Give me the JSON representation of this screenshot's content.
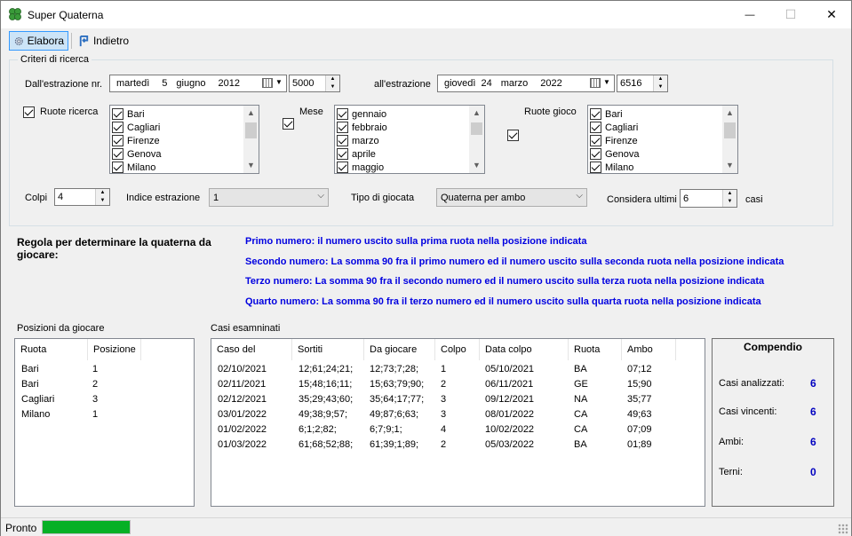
{
  "window": {
    "title": "Super Quaterna",
    "minimize": "—",
    "maximize": "☐",
    "close": "✕"
  },
  "toolbar": {
    "elabora": "Elabora",
    "indietro": "Indietro"
  },
  "criteria": {
    "group_title": "Criteri di ricerca",
    "from_label": "Dall'estrazione nr.",
    "from_date": {
      "day_name": "martedì",
      "day": "5",
      "month": "giugno",
      "year": "2012"
    },
    "from_number": "5000",
    "to_label": "all'estrazione",
    "to_date": {
      "day_name": "giovedì",
      "day": "24",
      "month": "marzo",
      "year": "2022"
    },
    "to_number": "6516",
    "ruote_ricerca_label": "Ruote ricerca",
    "ruote_ricerca": [
      "Bari",
      "Cagliari",
      "Firenze",
      "Genova",
      "Milano"
    ],
    "mese_label": "Mese",
    "mesi": [
      "gennaio",
      "febbraio",
      "marzo",
      "aprile",
      "maggio"
    ],
    "ruote_gioco_label": "Ruote gioco",
    "ruote_gioco": [
      "Bari",
      "Cagliari",
      "Firenze",
      "Genova",
      "Milano"
    ],
    "colpi_label": "Colpi",
    "colpi": "4",
    "indice_label": "Indice estrazione",
    "indice": "1",
    "tipo_label": "Tipo di giocata",
    "tipo": "Quaterna per ambo",
    "considera_label": "Considera ultimi",
    "considera": "6",
    "casi_label": "casi"
  },
  "rules": {
    "heading": "Regola per determinare la quaterna da giocare:",
    "line1": "Primo numero: il numero uscito sulla prima ruota nella posizione indicata",
    "line2": "Secondo numero: La somma 90 fra il primo numero ed il numero uscito sulla seconda ruota nella posizione indicata",
    "line3": "Terzo numero: La somma 90 fra il secondo numero ed il numero uscito sulla terza ruota nella posizione indicata",
    "line4": "Quarto numero: La somma 90 fra il terzo numero ed il numero uscito sulla quarta ruota nella posizione indicata"
  },
  "posizioni": {
    "title": "Posizioni da giocare",
    "headers": [
      "Ruota",
      "Posizione"
    ],
    "rows": [
      [
        "Bari",
        "1"
      ],
      [
        "Bari",
        "2"
      ],
      [
        "Cagliari",
        "3"
      ],
      [
        "Milano",
        "1"
      ]
    ]
  },
  "casi": {
    "title": "Casi esamninati",
    "headers": [
      "Caso del",
      "Sortiti",
      "Da giocare",
      "Colpo",
      "Data colpo",
      "Ruota",
      "Ambo"
    ],
    "rows": [
      [
        "02/10/2021",
        "12;61;24;21;",
        "12;73;7;28;",
        "1",
        "05/10/2021",
        "BA",
        "07;12"
      ],
      [
        "02/11/2021",
        "15;48;16;11;",
        "15;63;79;90;",
        "2",
        "06/11/2021",
        "GE",
        "15;90"
      ],
      [
        "02/12/2021",
        "35;29;43;60;",
        "35;64;17;77;",
        "3",
        "09/12/2021",
        "NA",
        "35;77"
      ],
      [
        "03/01/2022",
        "49;38;9;57;",
        "49;87;6;63;",
        "3",
        "08/01/2022",
        "CA",
        "49;63"
      ],
      [
        "01/02/2022",
        "6;1;2;82;",
        "6;7;9;1;",
        "4",
        "10/02/2022",
        "CA",
        "07;09"
      ],
      [
        "01/03/2022",
        "61;68;52;88;",
        "61;39;1;89;",
        "2",
        "05/03/2022",
        "BA",
        "01;89"
      ]
    ]
  },
  "compendio": {
    "title": "Compendio",
    "casi_analizzati_label": "Casi analizzati:",
    "casi_analizzati": "6",
    "casi_vincenti_label": "Casi vincenti:",
    "casi_vincenti": "6",
    "ambi_label": "Ambi:",
    "ambi": "6",
    "terni_label": "Terni:",
    "terni": "0"
  },
  "status": {
    "text": "Pronto",
    "progress": 1.0,
    "progress_color": "#06b025"
  }
}
